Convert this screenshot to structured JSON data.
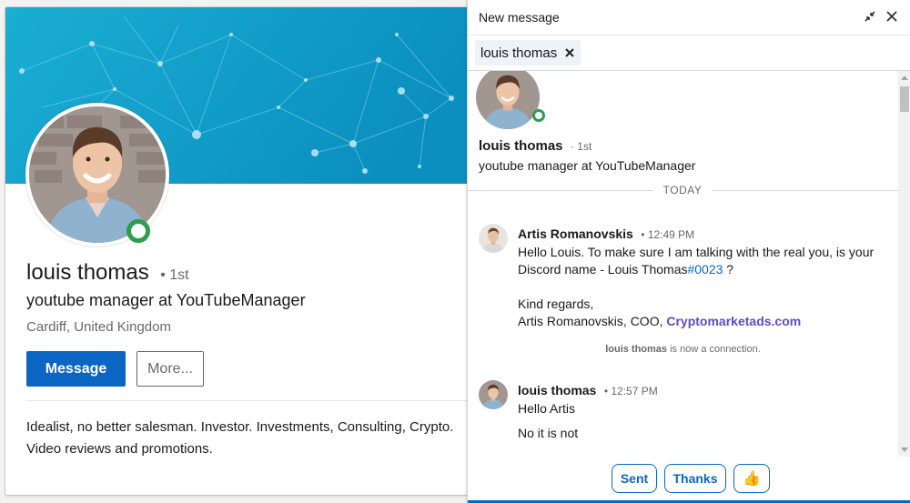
{
  "profile": {
    "name": "louis thomas",
    "degree_sep": "•",
    "degree": "1st",
    "headline": "youtube manager at YouTubeManager",
    "location": "Cardiff, United Kingdom",
    "message_button": "Message",
    "more_button": "More...",
    "summary_lines": [
      "Idealist, no better salesman. Investor. Investments, Consulting, Crypto.",
      "Video reviews and promotions."
    ],
    "banner_color": "#0aa3c9"
  },
  "message_panel": {
    "title": "New message",
    "recipient": "louis thomas",
    "thread_header": {
      "name": "louis thomas",
      "degree": "· 1st",
      "headline": "youtube manager at YouTubeManager"
    },
    "day_separator": "TODAY",
    "messages": [
      {
        "sender": "Artis Romanovskis",
        "time": "• 12:49 PM",
        "line1": "Hello Louis. To make sure I am talking with the real you, is your",
        "line2_prefix": "Discord name - Louis Thomas",
        "line2_hashtag": "#0023",
        "line2_suffix": " ?",
        "line3": "Kind regards,",
        "line4_prefix": "Artis Romanovskis, COO, ",
        "line4_link": "Cryptomarketads.com"
      },
      {
        "sender": "louis thomas",
        "time": "• 12:57 PM",
        "line1": "Hello Artis",
        "line2": "No it is not"
      }
    ],
    "connection_note": {
      "name": "louis thomas",
      "text": " is now a connection."
    },
    "quick_replies": [
      "Sent",
      "Thanks"
    ],
    "quick_reply_emoji": "👍",
    "accent_color": "#0a66c2",
    "online_color": "#2e9d4d"
  }
}
